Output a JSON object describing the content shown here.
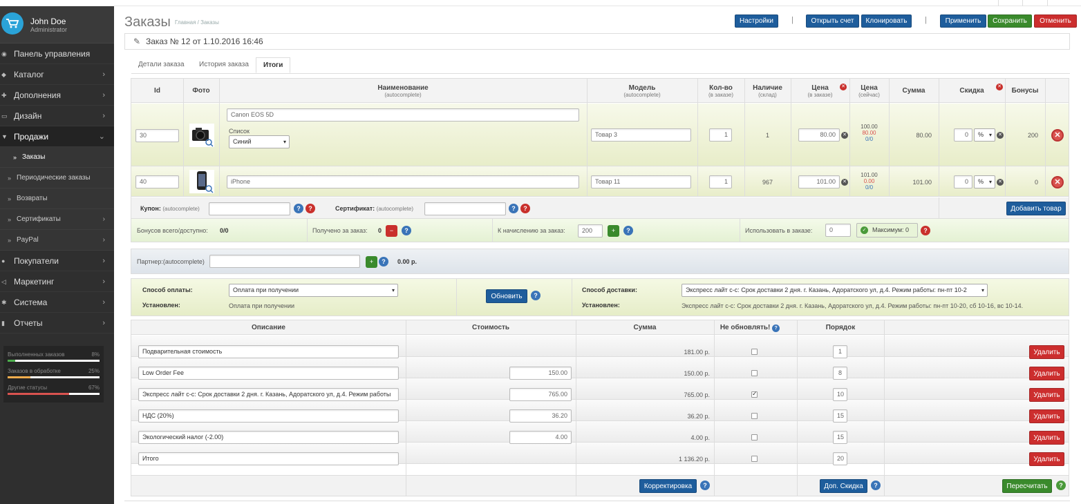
{
  "user": {
    "name": "John Doe",
    "role": "Administrator"
  },
  "menu": [
    {
      "label": "Панель управления",
      "icon": "dashboard-icon",
      "arrow": false
    },
    {
      "label": "Каталог",
      "icon": "tag-icon",
      "arrow": true
    },
    {
      "label": "Дополнения",
      "icon": "puzzle-icon",
      "arrow": true
    },
    {
      "label": "Дизайн",
      "icon": "monitor-icon",
      "arrow": true
    },
    {
      "label": "Продажи",
      "icon": "cart-icon",
      "arrow": true
    }
  ],
  "sales_submenu": [
    {
      "label": "Заказы",
      "arrow": false
    },
    {
      "label": "Периодические заказы",
      "arrow": false
    },
    {
      "label": "Возвраты",
      "arrow": false
    },
    {
      "label": "Сертификаты",
      "arrow": true
    },
    {
      "label": "PayPal",
      "arrow": true
    }
  ],
  "menu_bottom": [
    {
      "label": "Покупатели",
      "icon": "user-icon"
    },
    {
      "label": "Маркетинг",
      "icon": "share-icon"
    },
    {
      "label": "Система",
      "icon": "gear-icon"
    },
    {
      "label": "Отчеты",
      "icon": "bar-chart-icon"
    }
  ],
  "stats": [
    {
      "label": "Выполненных заказов",
      "value": "8%",
      "percent": 8,
      "color": "#4cae4c"
    },
    {
      "label": "Заказов в обработке",
      "value": "25%",
      "percent": 25,
      "color": "#f0ad4e"
    },
    {
      "label": "Другие статусы",
      "value": "67%",
      "percent": 67,
      "color": "#d9534f"
    }
  ],
  "page": {
    "title": "Заказы",
    "breadcrumb": "Главная / Заказы"
  },
  "toolbar": {
    "settings": "Настройки",
    "open_invoice": "Открыть счет",
    "clone": "Клонировать",
    "apply": "Применить",
    "save": "Сохранить",
    "cancel": "Отменить",
    "pipe": "|"
  },
  "order": {
    "title": "Заказ № 12 от 1.10.2016 16:46"
  },
  "tabs": [
    "Детали заказа",
    "История заказа",
    "Итоги"
  ],
  "product_headers": {
    "id": "Id",
    "photo": "Фото",
    "name": "Наименование",
    "name_sub": "(autocomplete)",
    "model": "Модель",
    "model_sub": "(autocomplete)",
    "qty": "Кол-во",
    "qty_sub": "(в заказе)",
    "stock": "Наличие",
    "stock_sub": "(склад)",
    "price": "Цена",
    "price_sub": "(в заказе)",
    "price_now": "Цена",
    "price_now_sub": "(сейчас)",
    "sum": "Сумма",
    "discount": "Скидка",
    "bonus": "Бонусы"
  },
  "products": [
    {
      "id": "30",
      "name": "Canon EOS 5D",
      "option_label": "Список",
      "option_value": "Синий",
      "model": "Товар 3",
      "qty": "1",
      "stock": "1",
      "price": "80.00",
      "price_now": [
        "100.00",
        "80.00",
        "0/0"
      ],
      "sum": "80.00",
      "discount": "0",
      "discount_type": "%",
      "bonus": "200"
    },
    {
      "id": "40",
      "name": "iPhone",
      "model": "Товар 11",
      "qty": "1",
      "stock": "967",
      "price": "101.00",
      "price_now": [
        "101.00",
        "0.00",
        "0/0"
      ],
      "sum": "101.00",
      "discount": "0",
      "discount_type": "%",
      "bonus": "0"
    }
  ],
  "coupon": {
    "label": "Купон:",
    "sub": "(autocomplete)"
  },
  "certificate": {
    "label": "Сертификат:",
    "sub": "(autocomplete)"
  },
  "add_product": "Добавить товар",
  "bonus": {
    "total_label": "Бонусов всего/доступно:",
    "total_value": "0/0",
    "received_label": "Получено за заказ:",
    "received_value": "0",
    "accrue_label": "К начислению за заказ:",
    "accrue_value": "200",
    "use_label": "Использовать в заказе:",
    "use_value": "0",
    "max_label": "Максимум: 0"
  },
  "partner": {
    "label": "Партнер:(autocomplete)",
    "amount": "0.00 р."
  },
  "payment": {
    "label": "Способ оплаты:",
    "value": "Оплата при получении",
    "set_label": "Установлен:",
    "set_value": "Оплата при получении"
  },
  "update_button": "Обновить",
  "shipping": {
    "label": "Способ доставки:",
    "value": "Экспресс лайт с-с: Срок доставки 2 дня. г. Казань, Адоратского ул, д.4. Режим работы: пн-пт 10-2",
    "set_label": "Установлен:",
    "set_value": "Экспресс лайт с-с: Срок доставки 2 дня. г. Казань, Адоратского ул, д.4. Режим работы: пн-пт 10-20, сб 10-16, вс 10-14."
  },
  "totals_headers": {
    "desc": "Описание",
    "cost": "Стоимость",
    "sum": "Сумма",
    "no_update": "Не обновлять!",
    "order": "Порядок"
  },
  "totals": [
    {
      "desc": "Подварительная стоимость",
      "cost": "",
      "sum": "181.00 р.",
      "checked": false,
      "order": "1"
    },
    {
      "desc": "Low Order Fee",
      "cost": "150.00",
      "sum": "150.00 р.",
      "checked": false,
      "order": "8"
    },
    {
      "desc": "Экспресс лайт с-с: Срок доставки 2 дня. г. Казань, Адоратского ул, д.4. Режим работы",
      "cost": "765.00",
      "sum": "765.00 р.",
      "checked": true,
      "order": "10"
    },
    {
      "desc": "НДС (20%)",
      "cost": "36.20",
      "sum": "36.20 р.",
      "checked": false,
      "order": "15"
    },
    {
      "desc": "Экологический налог (-2.00)",
      "cost": "4.00",
      "sum": "4.00 р.",
      "checked": false,
      "order": "15"
    },
    {
      "desc": "Итого",
      "cost": "",
      "sum": "1 136.20 р.",
      "checked": false,
      "order": "20"
    }
  ],
  "delete_label": "Удалить",
  "footer_buttons": {
    "correct": "Корректировка",
    "extra_discount": "Доп. Скидка",
    "recalc": "Пересчитать"
  },
  "colors": {
    "sidebar": "#2f2f2f",
    "primary": "#1e5d9c",
    "success": "#3a8a2c",
    "danger": "#cc2e2e",
    "row_highlight": "#eef2d8"
  }
}
